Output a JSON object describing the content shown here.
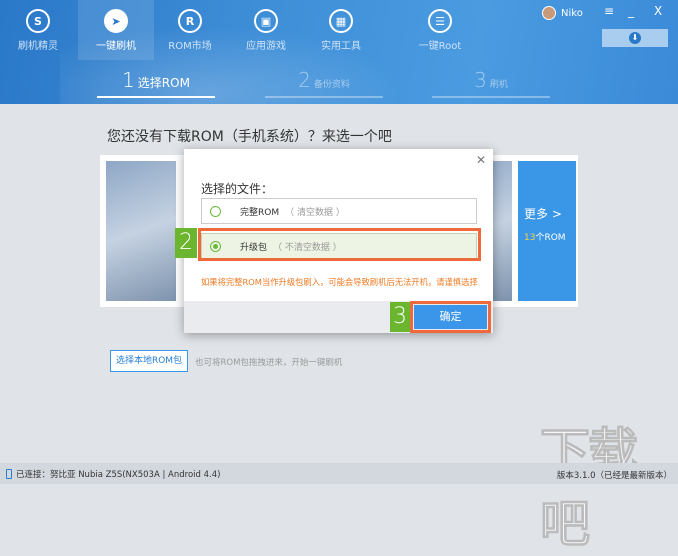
{
  "nav": [
    {
      "label": "刷机精灵",
      "icon": "S"
    },
    {
      "label": "一键刷机",
      "icon": "➤"
    },
    {
      "label": "ROM市场",
      "icon": "R"
    },
    {
      "label": "应用游戏",
      "icon": "▣"
    },
    {
      "label": "实用工具",
      "icon": "▦"
    },
    {
      "label": "一键Root",
      "icon": "☰"
    }
  ],
  "user": {
    "name": "Niko"
  },
  "window": {
    "menu": "≡",
    "minimize": "_",
    "close": "X",
    "download": "⬇"
  },
  "steps": [
    {
      "num": "1",
      "label": "选择ROM"
    },
    {
      "num": "2",
      "label": "备份资料"
    },
    {
      "num": "3",
      "label": "刷机"
    }
  ],
  "main": {
    "heading": "您还没有下载ROM（手机系统）？来选一个吧",
    "more": "更多 >",
    "count_num": "13",
    "count_suffix": "个ROM",
    "local_button": "选择本地ROM包",
    "hint": "也可将ROM包拖拽进来，开始一键刷机"
  },
  "dialog": {
    "close": "✕",
    "title": "选择的文件：",
    "options": [
      {
        "label": "完整ROM",
        "note": "（ 清空数据 ）",
        "selected": false
      },
      {
        "label": "升级包",
        "note": "（ 不清空数据 ）",
        "selected": true
      }
    ],
    "warning": "如果将完整ROM当作升级包刷入，可能会导致刷机后无法开机，请谨慎选择",
    "ok": "确定"
  },
  "annotations": [
    "2",
    "3"
  ],
  "status": {
    "connected": "已连接：努比亚 Nubia Z5S(NX503A | Android 4.4)",
    "version": "版本3.1.0（已经是最新版本）"
  },
  "watermark": "下载吧",
  "colors": {
    "accent": "#3b96ea",
    "highlight": "#ee6a3c",
    "badge": "#6cb52f",
    "warning": "#f07a22"
  }
}
